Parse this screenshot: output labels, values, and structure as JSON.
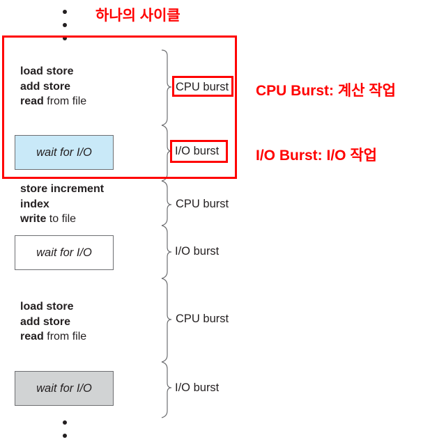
{
  "title": "하나의 사이클",
  "colors": {
    "annotation": "#ff0000",
    "highlight_box": "#c9e9f8",
    "gray_box": "#d1d3d4",
    "white_box": "#ffffff",
    "text": "#231f20"
  },
  "sequence": [
    {
      "type": "cpu",
      "lines": [
        {
          "bold": "load store",
          "rest": ""
        },
        {
          "bold": "add store",
          "rest": ""
        },
        {
          "bold": "read",
          "rest": " from file"
        }
      ],
      "burst_label": "CPU burst"
    },
    {
      "type": "io",
      "box_label": "wait for I/O",
      "box_fill": "light-blue",
      "burst_label": "I/O burst"
    },
    {
      "type": "cpu",
      "lines": [
        {
          "bold": "store increment",
          "rest": ""
        },
        {
          "bold": "index",
          "rest": ""
        },
        {
          "bold": "write",
          "rest": " to file"
        }
      ],
      "burst_label": "CPU burst"
    },
    {
      "type": "io",
      "box_label": "wait for I/O",
      "box_fill": "white",
      "burst_label": "I/O burst"
    },
    {
      "type": "cpu",
      "lines": [
        {
          "bold": "load store",
          "rest": ""
        },
        {
          "bold": "add store",
          "rest": ""
        },
        {
          "bold": "read",
          "rest": " from file"
        }
      ],
      "burst_label": "CPU burst"
    },
    {
      "type": "io",
      "box_label": "wait for I/O",
      "box_fill": "gray",
      "burst_label": "I/O burst"
    }
  ],
  "annotations": {
    "cpu_burst": "CPU Burst: 계산 작업",
    "io_burst": "I/O Burst: I/O 작업"
  }
}
